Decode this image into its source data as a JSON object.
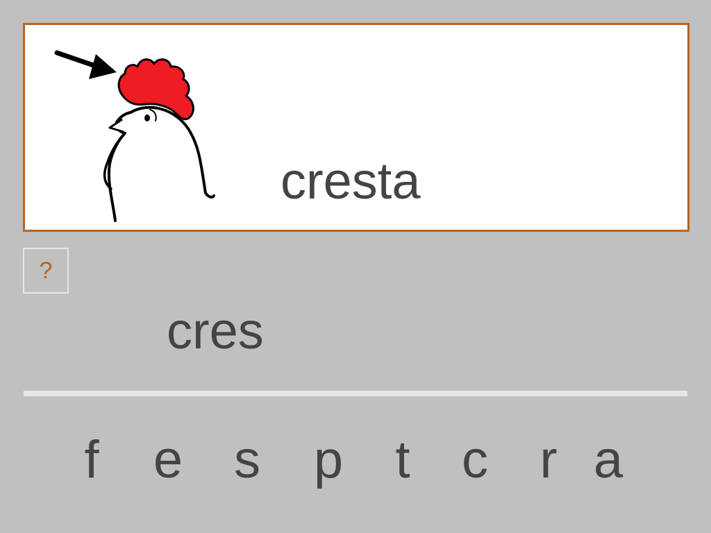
{
  "card": {
    "word": "cresta",
    "image_icon": "rooster-comb-icon",
    "border_color": "#b5651d"
  },
  "help": {
    "label": "?"
  },
  "answer": {
    "typed": "cres"
  },
  "letters": [
    "f",
    "e",
    "s",
    "p",
    "t",
    "c",
    "r",
    "a"
  ],
  "colors": {
    "background": "#c0c0c0",
    "text": "#444444",
    "comb": "#ee1c24",
    "accent": "#b5651d"
  }
}
